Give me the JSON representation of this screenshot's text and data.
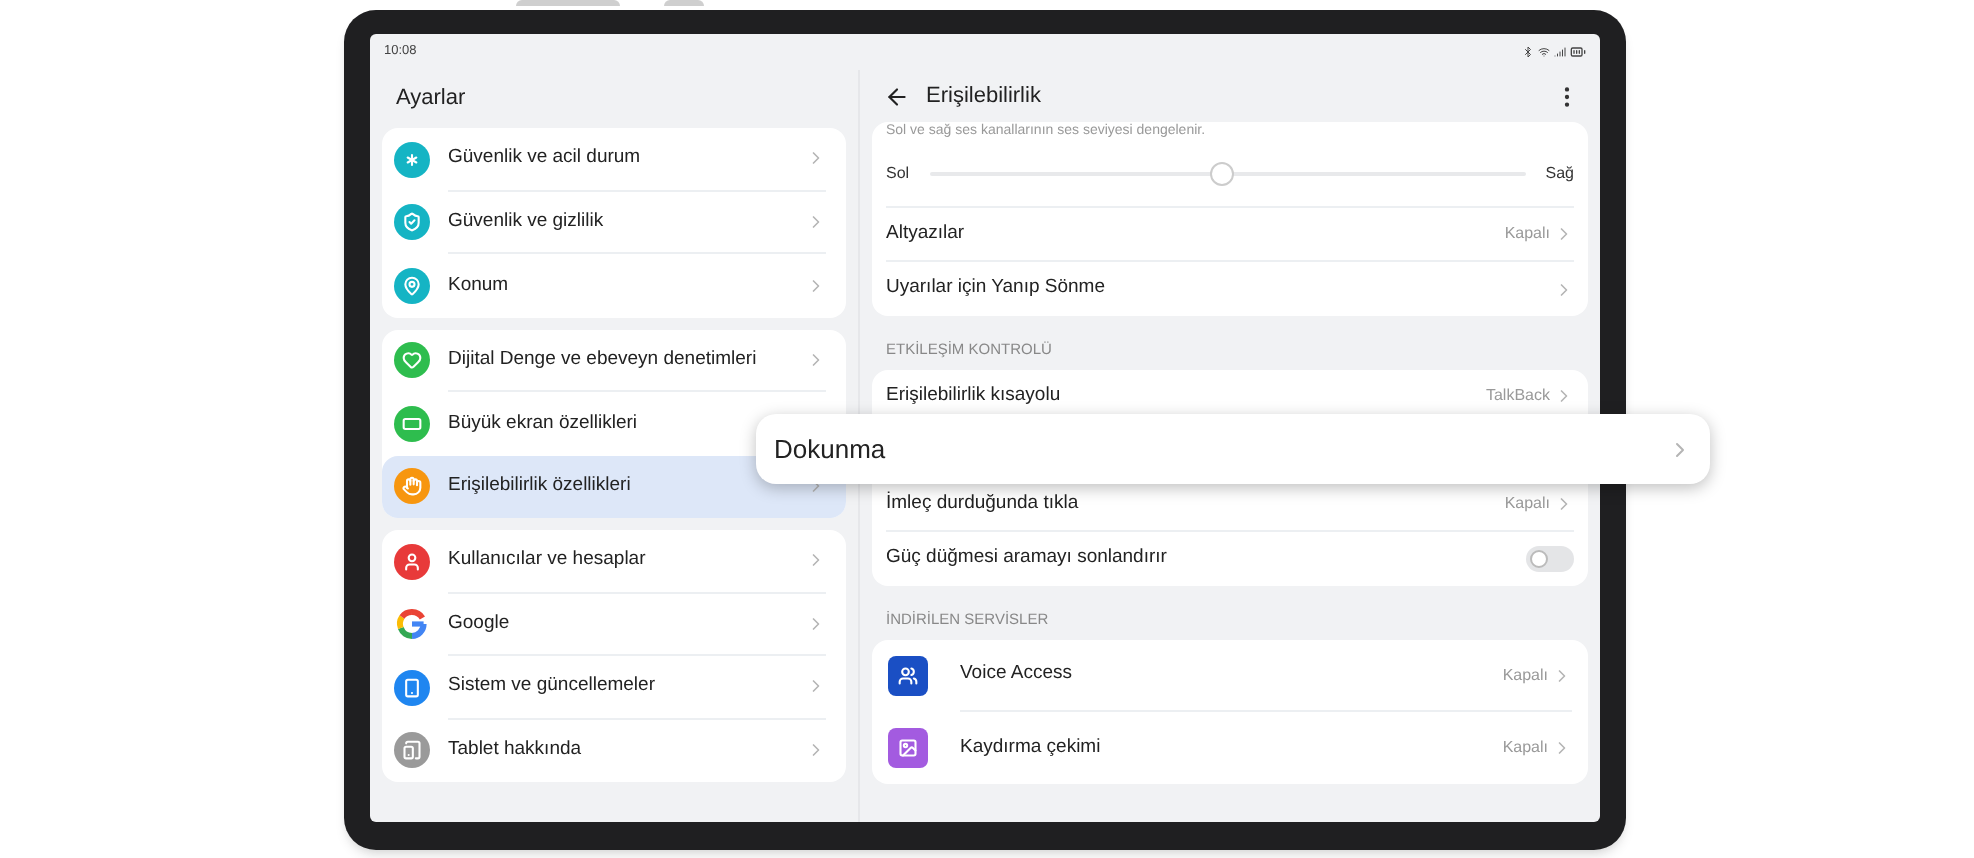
{
  "status_bar": {
    "time": "10:08"
  },
  "settings": {
    "title": "Ayarlar",
    "groups": [
      [
        {
          "label": "Güvenlik ve acil durum",
          "color": "#15b4c4",
          "selected": false
        },
        {
          "label": "Güvenlik ve gizlilik",
          "color": "#15b4c4",
          "selected": false
        },
        {
          "label": "Konum",
          "color": "#15b4c4",
          "selected": false
        }
      ],
      [
        {
          "label": "Dijital Denge ve ebeveyn denetimleri",
          "color": "#2ebd4e",
          "selected": false
        },
        {
          "label": "Büyük ekran özellikleri",
          "color": "#2ebd4e",
          "selected": false,
          "chevron": false
        },
        {
          "label": "Erişilebilirlik özellikleri",
          "color": "#f7960f",
          "selected": true
        }
      ],
      [
        {
          "label": "Kullanıcılar ve hesaplar",
          "color": "#e83a3a",
          "selected": false
        },
        {
          "label": "Google",
          "selected": false
        },
        {
          "label": "Sistem ve güncellemeler",
          "color": "#1f86f0",
          "selected": false
        },
        {
          "label": "Tablet hakkında",
          "color": "#9a9a9a",
          "selected": false
        }
      ]
    ]
  },
  "detail": {
    "title": "Erişilebilirlik",
    "balance": {
      "caption": "Sol ve sağ ses kanallarının ses seviyesi dengelenir.",
      "left_label": "Sol",
      "right_label": "Sağ",
      "level": 0.49
    },
    "sections": [
      {
        "rows": [
          {
            "kind": "link",
            "label": "Altyazılar",
            "value": "Kapalı"
          },
          {
            "kind": "link",
            "label": "Uyarılar için Yanıp Sönme"
          }
        ]
      },
      {
        "header": "ETKİLEŞİM KONTROLÜ",
        "rows": [
          {
            "kind": "link",
            "label": "Erişilebilirlik kısayolu",
            "value": "TalkBack"
          },
          {
            "kind": "link",
            "label": "İmleç durduğunda tıkla",
            "value": "Kapalı"
          },
          {
            "kind": "toggle",
            "label": "Güç düğmesi aramayı sonlandırır",
            "on": false
          }
        ]
      },
      {
        "header": "İNDİRİLEN SERVİSLER",
        "rows": [
          {
            "kind": "service",
            "label": "Voice Access",
            "value": "Kapalı",
            "color": "#1a4fc4"
          },
          {
            "kind": "service",
            "label": "Kaydırma çekimi",
            "value": "Kapalı",
            "color": "#a35be0"
          }
        ]
      }
    ]
  },
  "popup": {
    "label": "Dokunma"
  }
}
